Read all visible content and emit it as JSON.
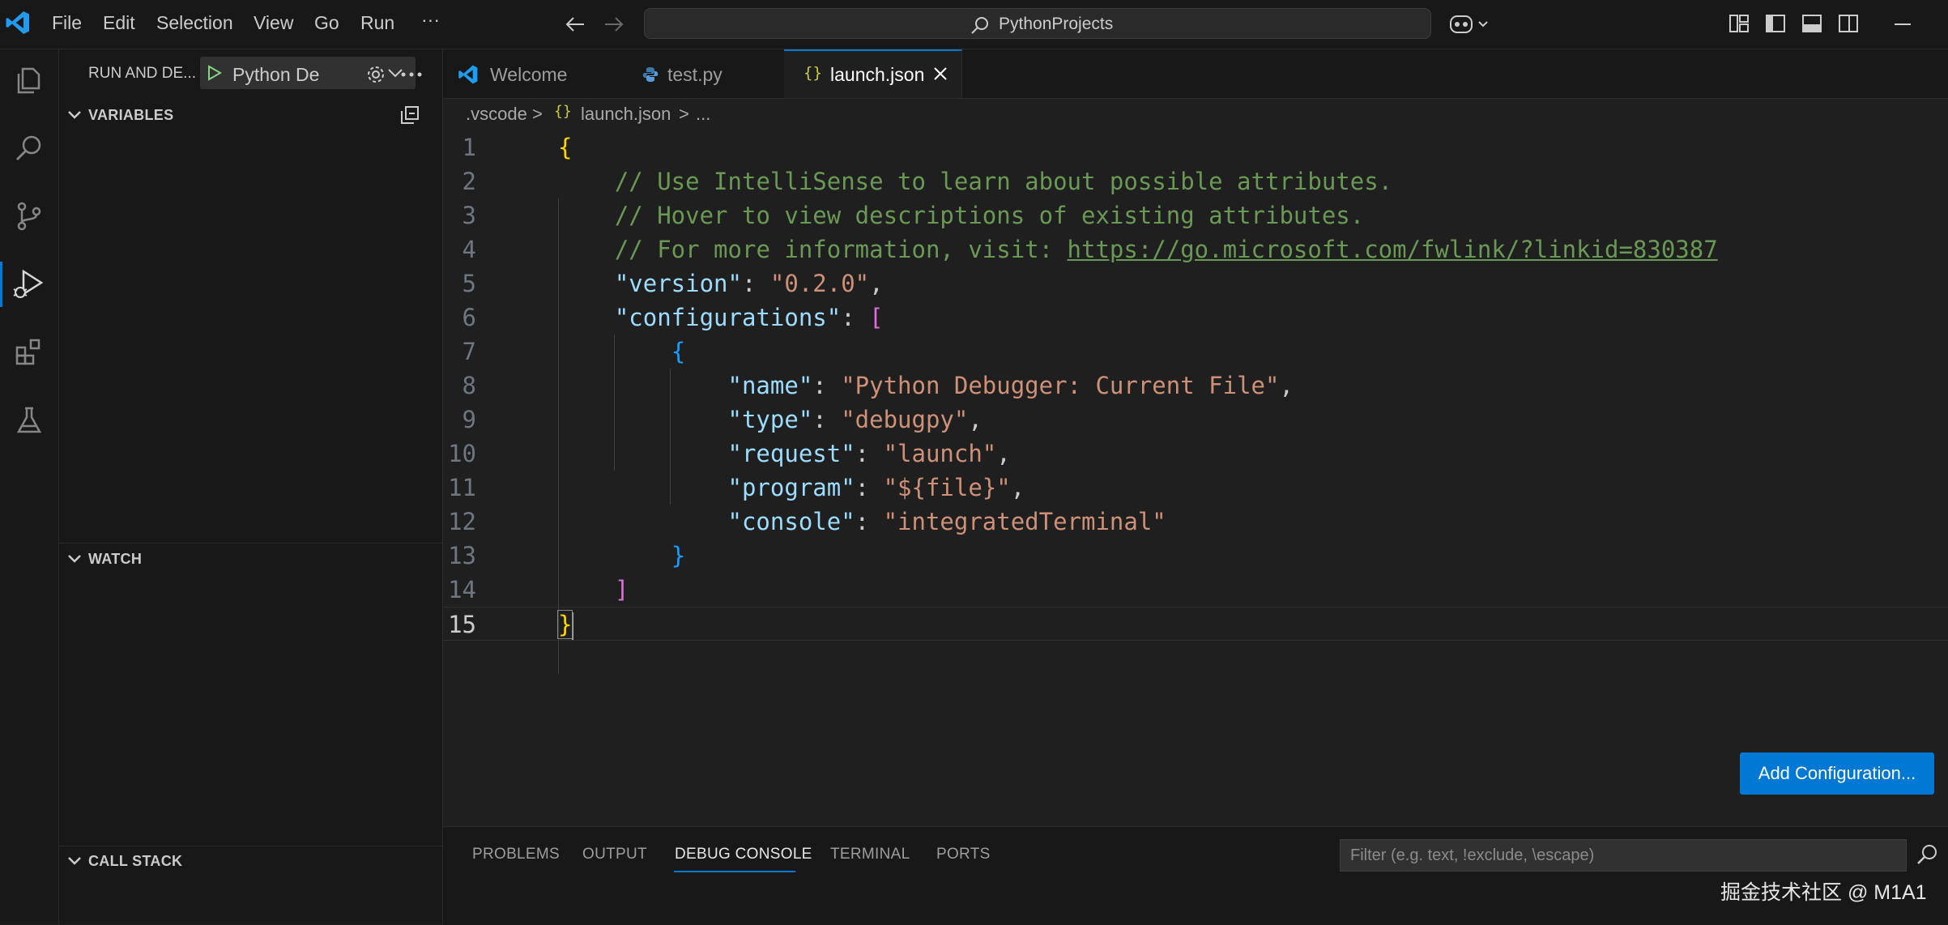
{
  "menu": [
    "File",
    "Edit",
    "Selection",
    "View",
    "Go",
    "Run",
    "···"
  ],
  "search": {
    "label": "PythonProjects"
  },
  "sidebar": {
    "title": "RUN AND DE...",
    "config_select": "Python De",
    "sections": {
      "variables": "VARIABLES",
      "watch": "WATCH",
      "call_stack": "CALL STACK"
    }
  },
  "tabs": [
    {
      "label": "Welcome"
    },
    {
      "label": "test.py"
    },
    {
      "label": "launch.json"
    }
  ],
  "breadcrumb": {
    "folder": ".vscode",
    "sep": ">",
    "file": "launch.json",
    "more": "..."
  },
  "code": {
    "line_numbers": [
      "1",
      "2",
      "3",
      "4",
      "5",
      "6",
      "7",
      "8",
      "9",
      "10",
      "11",
      "12",
      "13",
      "14",
      "15"
    ],
    "open_brace": "{",
    "comment1": "// Use IntelliSense to learn about possible attributes.",
    "comment2": "// Hover to view descriptions of existing attributes.",
    "comment3_prefix": "// For more information, visit: ",
    "comment3_link": "https://go.microsoft.com/fwlink/?linkid=830387",
    "version_key": "\"version\"",
    "version_val": "\"0.2.0\"",
    "configurations_key": "\"configurations\"",
    "open_bracket": "[",
    "obj_open": "{",
    "name_key": "\"name\"",
    "name_val": "\"Python Debugger: Current File\"",
    "type_key": "\"type\"",
    "type_val": "\"debugpy\"",
    "request_key": "\"request\"",
    "request_val": "\"launch\"",
    "program_key": "\"program\"",
    "program_val": "\"${file}\"",
    "console_key": "\"console\"",
    "console_val": "\"integratedTerminal\"",
    "obj_close": "}",
    "close_bracket": "]",
    "close_brace": "}",
    "colon": ": ",
    "comma": ","
  },
  "add_configuration": "Add Configuration...",
  "panel": {
    "tabs": [
      "PROBLEMS",
      "OUTPUT",
      "DEBUG CONSOLE",
      "TERMINAL",
      "PORTS"
    ],
    "active_tab": "DEBUG CONSOLE",
    "filter_placeholder": "Filter (e.g. text, !exclude, \\escape)"
  },
  "watermark": "掘金技术社区 @ M1A1",
  "colors": {
    "accent": "#0078d4",
    "background": "#1f1f1f",
    "sidebar": "#181818"
  },
  "icons": [
    "vscode-logo-icon",
    "explorer-icon",
    "search-icon",
    "source-control-icon",
    "run-debug-icon",
    "extensions-icon",
    "testing-icon",
    "copilot-icon",
    "layout-icon",
    "play-icon",
    "gear-icon",
    "more-icon",
    "collapse-all-icon",
    "json-icon",
    "python-icon",
    "close-icon",
    "filter-icon",
    "arrow-left-icon",
    "arrow-right-icon",
    "minimize-icon"
  ]
}
